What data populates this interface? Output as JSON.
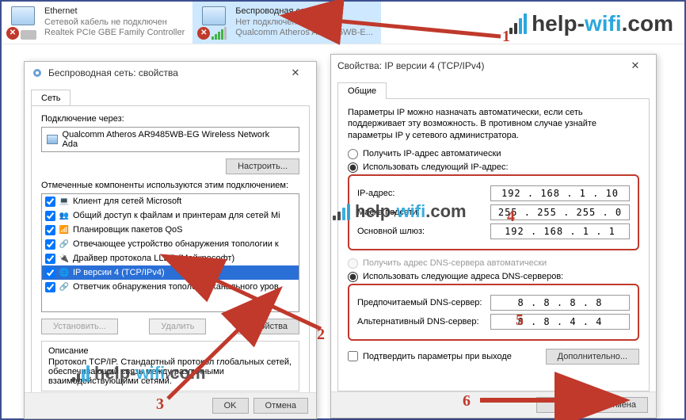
{
  "adapters": [
    {
      "name": "Ethernet",
      "status": "Сетевой кабель не подключен",
      "driver": "Realtek PCIe GBE Family Controller"
    },
    {
      "name": "Беспроводная сеть",
      "status": "Нет подключения",
      "driver": "Qualcomm Atheros AR9485WB-E..."
    }
  ],
  "watermark": {
    "a": "help-",
    "b": "wifi",
    "c": ".com"
  },
  "props_dialog": {
    "title": "Беспроводная сеть: свойства",
    "tab": "Сеть",
    "connect_via_label": "Подключение через:",
    "adapter_name": "Qualcomm Atheros AR9485WB-EG Wireless Network Ada",
    "configure_btn": "Настроить...",
    "components_label": "Отмеченные компоненты используются этим подключением:",
    "components": [
      "Клиент для сетей Microsoft",
      "Общий доступ к файлам и принтерам для сетей Мі",
      "Планировщик пакетов QoS",
      "Отвечающее устройство обнаружения топологии к",
      "Драйвер протокола LLDP (Майкрософт)",
      "IP версии 4 (TCP/IPv4)",
      "Ответчик обнаружения топологии канального уров"
    ],
    "install_btn": "Установить...",
    "remove_btn": "Удалить",
    "props_btn": "Свойства",
    "desc_head": "Описание",
    "desc_text": "Протокол TCP/IP. Стандартный протокол глобальных сетей, обеспечивающий связь между различными взаимодействующими сетями.",
    "ok": "OK",
    "cancel": "Отмена"
  },
  "ipv4_dialog": {
    "title": "Свойства: IP версии 4 (TCP/IPv4)",
    "tab": "Общие",
    "intro": "Параметры IP можно назначать автоматически, если сеть поддерживает эту возможность. В противном случае узнайте параметры IP у сетевого администратора.",
    "radio_auto_ip": "Получить IP-адрес автоматически",
    "radio_manual_ip": "Использовать следующий IP-адрес:",
    "ip_label": "IP-адрес:",
    "ip_value": "192 . 168 .  1  . 10",
    "mask_label": "Маска подсети:",
    "mask_value": "255 . 255 . 255 .  0",
    "gw_label": "Основной шлюз:",
    "gw_value": "192 . 168 .  1  .  1",
    "radio_auto_dns": "Получить адрес DNS-сервера автоматически",
    "radio_manual_dns": "Использовать следующие адреса DNS-серверов:",
    "dns1_label": "Предпочитаемый DNS-сервер:",
    "dns1_value": "8  .  8  .  8  .  8",
    "dns2_label": "Альтернативный DNS-сервер:",
    "dns2_value": "8  .  8  .  4  .  4",
    "validate_label": "Подтвердить параметры при выходе",
    "advanced_btn": "Дополнительно...",
    "ok": "OK",
    "cancel": "Отмена"
  },
  "callouts": {
    "n1": "1",
    "n2": "2",
    "n3": "3",
    "n4": "4",
    "n5": "5",
    "n6": "6"
  }
}
